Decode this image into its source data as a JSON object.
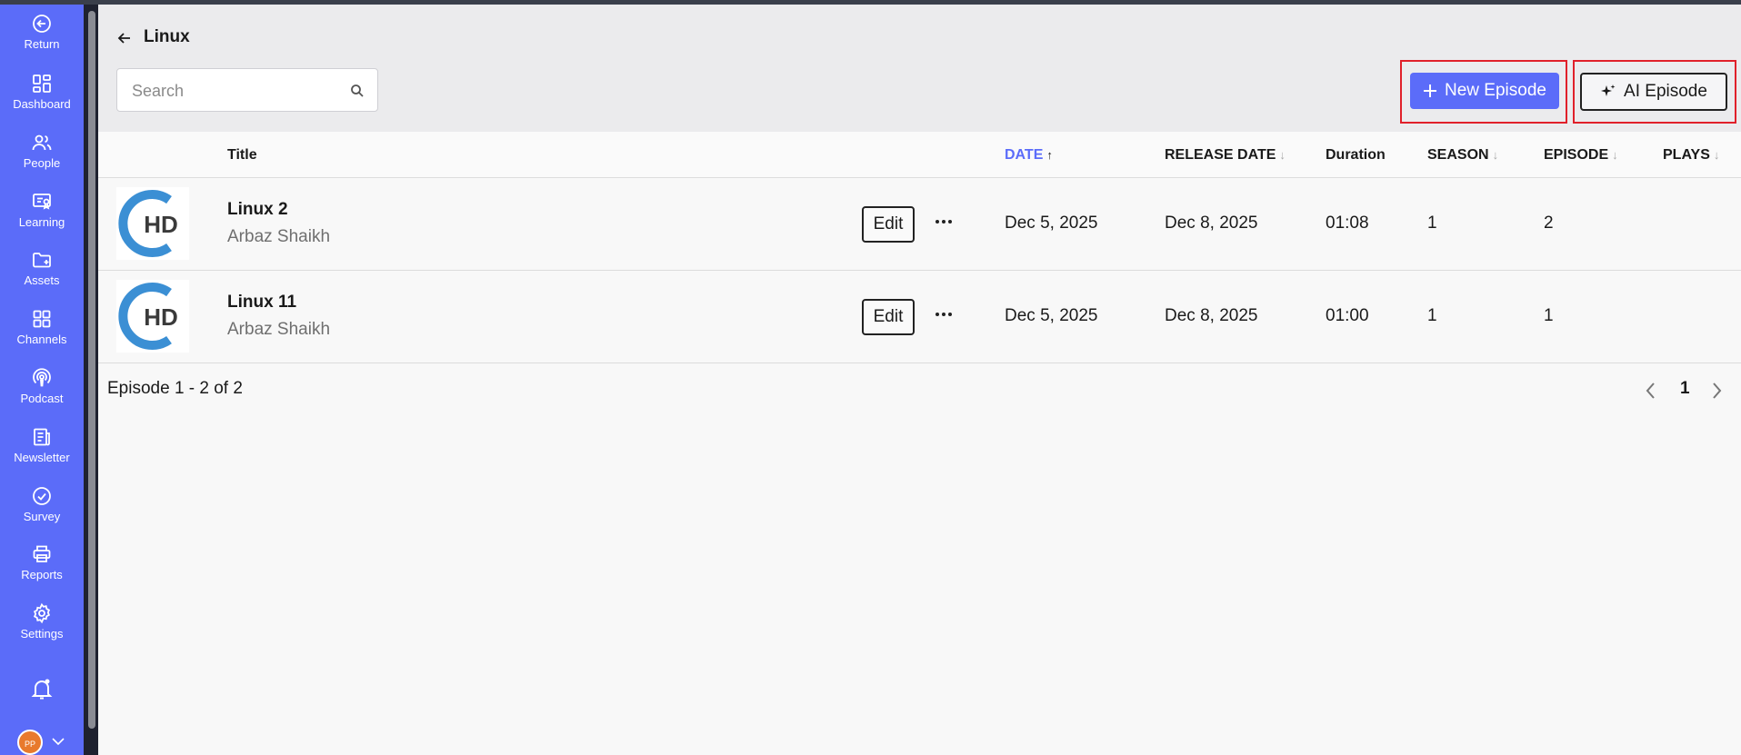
{
  "sidebar": {
    "items": [
      {
        "label": "Return",
        "icon": "return-icon"
      },
      {
        "label": "Dashboard",
        "icon": "dashboard-icon"
      },
      {
        "label": "People",
        "icon": "people-icon"
      },
      {
        "label": "Learning",
        "icon": "learning-icon"
      },
      {
        "label": "Assets",
        "icon": "assets-folder-icon"
      },
      {
        "label": "Channels",
        "icon": "channels-grid-icon"
      },
      {
        "label": "Podcast",
        "icon": "podcast-icon"
      },
      {
        "label": "Newsletter",
        "icon": "newsletter-icon"
      },
      {
        "label": "Survey",
        "icon": "survey-check-icon"
      },
      {
        "label": "Reports",
        "icon": "printer-icon"
      },
      {
        "label": "Settings",
        "icon": "gear-icon"
      }
    ],
    "avatar_initials": "PP"
  },
  "header": {
    "title": "Linux",
    "search_placeholder": "Search",
    "new_episode_label": "New Episode",
    "ai_episode_label": "AI Episode"
  },
  "table": {
    "columns": {
      "title": "Title",
      "date": "DATE",
      "release_date": "RELEASE DATE",
      "duration": "Duration",
      "season": "SEASON",
      "episode": "EPISODE",
      "plays": "PLAYS"
    },
    "edit_label": "Edit",
    "rows": [
      {
        "title": "Linux 2",
        "author": "Arbaz Shaikh",
        "date": "Dec 5, 2025",
        "release_date": "Dec 8, 2025",
        "duration": "01:08",
        "season": "1",
        "episode": "2",
        "plays": ""
      },
      {
        "title": "Linux 11",
        "author": "Arbaz Shaikh",
        "date": "Dec 5, 2025",
        "release_date": "Dec 8, 2025",
        "duration": "01:00",
        "season": "1",
        "episode": "1",
        "plays": ""
      }
    ]
  },
  "pagination": {
    "summary": "Episode 1 - 2 of 2",
    "current_page": "1"
  },
  "colors": {
    "accent": "#5b6cf9",
    "highlight": "#e0202a",
    "logo_blue": "#3b8fd4",
    "logo_dark": "#3a3a3a"
  }
}
